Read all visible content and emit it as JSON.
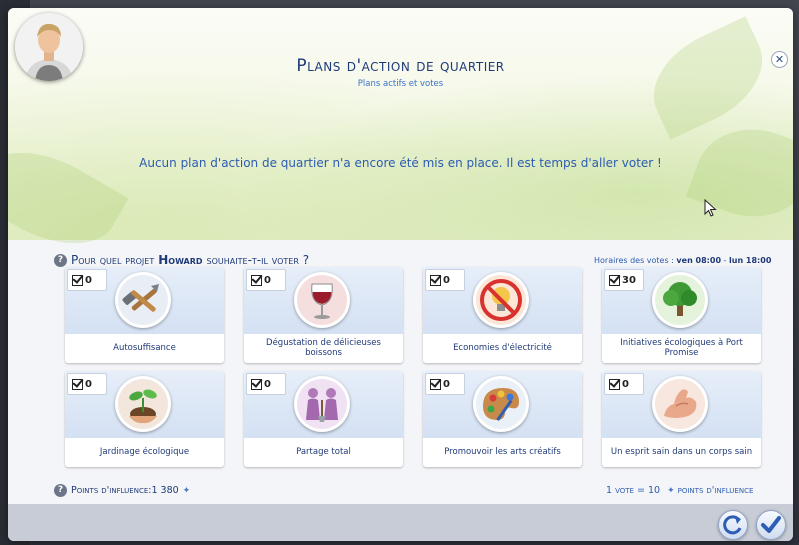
{
  "window": {
    "title": "Plans d'action de quartier",
    "subtitle": "Plans actifs et votes",
    "message": "Aucun plan d'action de quartier n'a encore été mis en place. Il est temps d'aller voter  !",
    "close_glyph": "✕"
  },
  "prompt": {
    "help_glyph": "?",
    "question_start": "Pour quel projet ",
    "sim_name": "Howard",
    "question_end": " souhaite-t-il voter  ?"
  },
  "vote_hours": {
    "label": "Horaires des votes",
    "separator": " : ",
    "start": "ven 08:00",
    "dash": " - ",
    "end": "lun 18:00"
  },
  "plans": [
    {
      "label": "Autosuffisance",
      "votes": "0",
      "icon": "tools-icon"
    },
    {
      "label": "Dégustation de délicieuses boissons",
      "votes": "0",
      "icon": "wine-glass-icon"
    },
    {
      "label": "Economies d'électricité",
      "votes": "0",
      "icon": "no-lightbulb-icon"
    },
    {
      "label": "Initiatives écologiques à Port Promise",
      "votes": "30",
      "icon": "tree-icon"
    },
    {
      "label": "Jardinage écologique",
      "votes": "0",
      "icon": "seedling-icon"
    },
    {
      "label": "Partage total",
      "votes": "0",
      "icon": "sharing-people-icon"
    },
    {
      "label": "Promouvoir les arts créatifs",
      "votes": "0",
      "icon": "paint-palette-icon"
    },
    {
      "label": "Un esprit sain dans un corps sain",
      "votes": "0",
      "icon": "flexed-arm-icon"
    }
  ],
  "footer": {
    "help_glyph": "?",
    "points_label": "Points d'influence",
    "points_value": " :1 380",
    "influence_glyph": "✦",
    "vote_rate": "1 vote = 10",
    "vote_rate_unit": "points d'influence"
  },
  "buttons": {
    "reset_icon": "refresh-icon",
    "confirm_icon": "checkmark-icon"
  },
  "colors": {
    "title": "#1f3a78",
    "accent": "#2c5cb0",
    "card_top": "#dfe8f6"
  }
}
